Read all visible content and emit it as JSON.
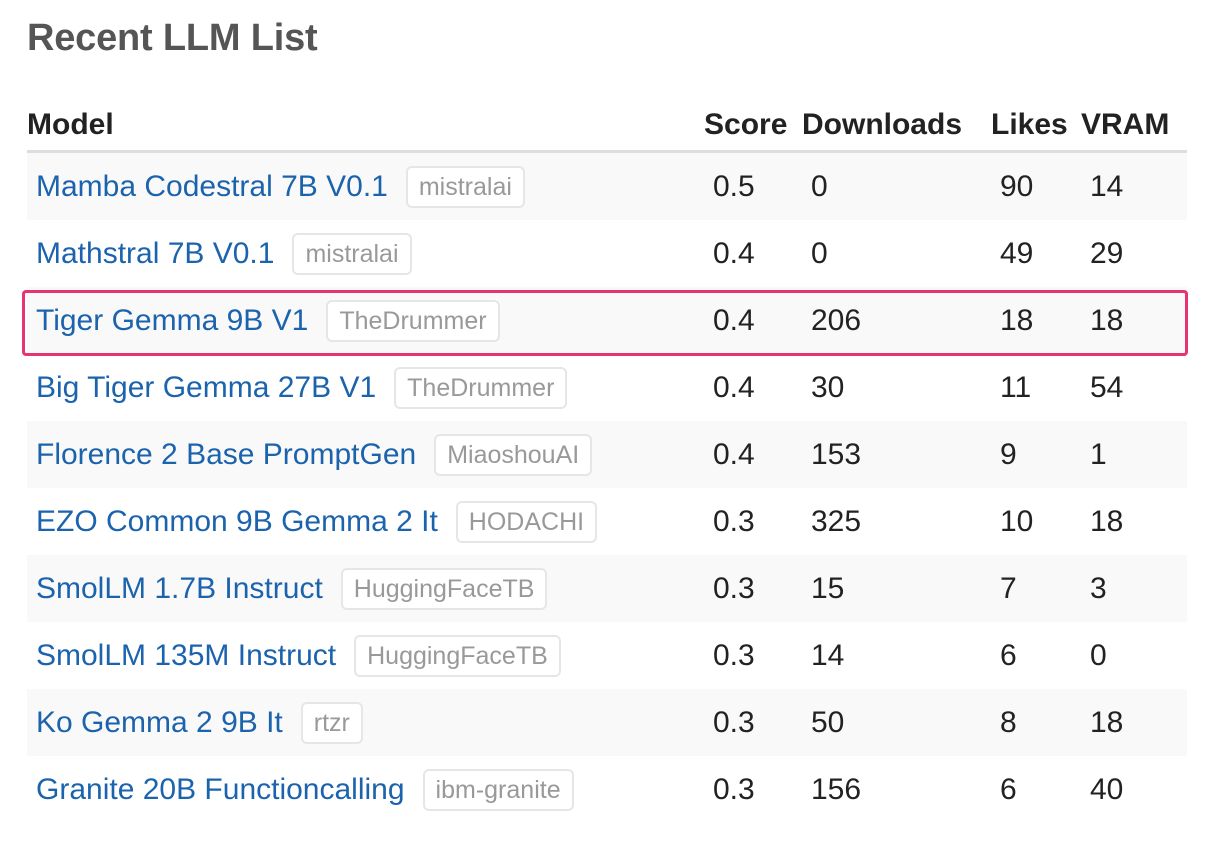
{
  "page": {
    "title": "Recent LLM List"
  },
  "table": {
    "headers": {
      "model": "Model",
      "score": "Score",
      "downloads": "Downloads",
      "likes": "Likes",
      "vram": "VRAM"
    },
    "rows": [
      {
        "model": "Mamba Codestral 7B V0.1",
        "author": "mistralai",
        "score": "0.5",
        "downloads": "0",
        "likes": "90",
        "vram": "14"
      },
      {
        "model": "Mathstral 7B V0.1",
        "author": "mistralai",
        "score": "0.4",
        "downloads": "0",
        "likes": "49",
        "vram": "29"
      },
      {
        "model": "Tiger Gemma 9B V1",
        "author": "TheDrummer",
        "score": "0.4",
        "downloads": "206",
        "likes": "18",
        "vram": "18"
      },
      {
        "model": "Big Tiger Gemma 27B V1",
        "author": "TheDrummer",
        "score": "0.4",
        "downloads": "30",
        "likes": "11",
        "vram": "54"
      },
      {
        "model": "Florence 2 Base PromptGen",
        "author": "MiaoshouAI",
        "score": "0.4",
        "downloads": "153",
        "likes": "9",
        "vram": "1"
      },
      {
        "model": "EZO Common 9B Gemma 2 It",
        "author": "HODACHI",
        "score": "0.3",
        "downloads": "325",
        "likes": "10",
        "vram": "18"
      },
      {
        "model": "SmolLM 1.7B Instruct",
        "author": "HuggingFaceTB",
        "score": "0.3",
        "downloads": "15",
        "likes": "7",
        "vram": "3"
      },
      {
        "model": "SmolLM 135M Instruct",
        "author": "HuggingFaceTB",
        "score": "0.3",
        "downloads": "14",
        "likes": "6",
        "vram": "0"
      },
      {
        "model": "Ko Gemma 2 9B It",
        "author": "rtzr",
        "score": "0.3",
        "downloads": "50",
        "likes": "8",
        "vram": "18"
      },
      {
        "model": "Granite 20B Functioncalling",
        "author": "ibm-granite",
        "score": "0.3",
        "downloads": "156",
        "likes": "6",
        "vram": "40"
      }
    ]
  },
  "colors": {
    "link": "#1b63ad",
    "highlight": "#e8336e",
    "title": "#555555"
  }
}
